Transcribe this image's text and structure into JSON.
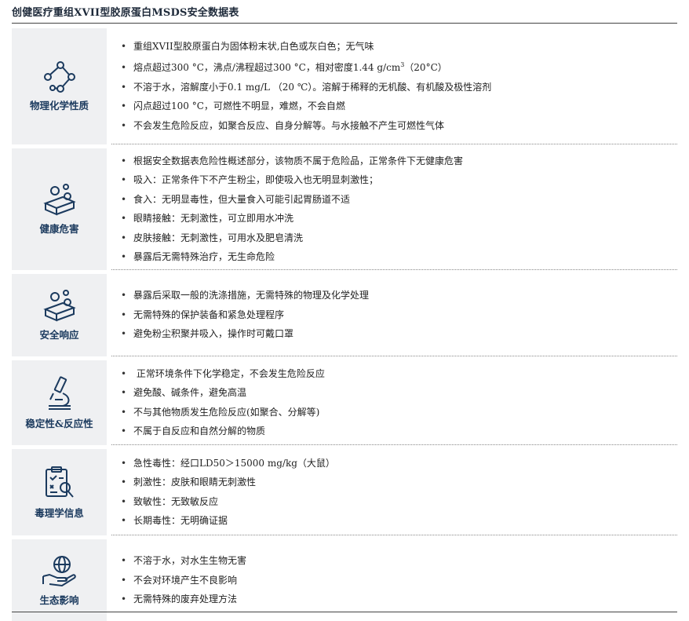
{
  "title": "创健医疗重组XVII型胶原蛋白MSDS安全数据表",
  "colors": {
    "label_bg": "#eff0f2",
    "label_text": "#1b3a5e",
    "icon_stroke": "#1b3a5e"
  },
  "sections": [
    {
      "label": "物理化学性质",
      "icon": "molecule-icon",
      "bullets": [
        "重组XVII型胶原蛋白为固体粉末状,白色或灰白色；无气味",
        "熔点超过300 °C，沸点/沸程超过300 °C，相对密度1.44 g/cm",
        "不溶于水，溶解度小于0.1 mg/L （20 ℃）。溶解于稀释的无机酸、有机酸及极性溶剂",
        "闪点超过100 °C，可燃性不明显，难燃，不会自燃",
        "不会发生危险反应，如聚合反应、自身分解等。与水接触不产生可燃性气体"
      ],
      "bullet2_sup": "3",
      "bullet2_tail": "（20°C）"
    },
    {
      "label": "健康危害",
      "icon": "soap-bubbles-icon",
      "bullets": [
        "根据安全数据表危险性概述部分，该物质不属于危险品，正常条件下无健康危害",
        "吸入：正常条件下不产生粉尘，即使吸入也无明显刺激性；",
        "食入：无明显毒性，但大量食入可能引起胃肠道不适",
        "眼睛接触：无刺激性，可立即用水冲洗",
        "皮肤接触：无刺激性，可用水及肥皂清洗",
        "暴露后无需特殊治疗，无生命危险"
      ]
    },
    {
      "label": "安全响应",
      "icon": "soap-bubbles-icon",
      "bullets": [
        "暴露后采取一般的洗涤措施，无需特殊的物理及化学处理",
        "无需特殊的保护装备和紧急处理程序",
        "避免粉尘积聚并吸入，操作时可戴口罩"
      ]
    },
    {
      "label": "稳定性&反应性",
      "icon": "microscope-icon",
      "bullets": [
        " 正常环境条件下化学稳定，不会发生危险反应",
        "避免酸、碱条件，避免高温",
        "不与其他物质发生危险反应(如聚合、分解等)",
        "不属于自反应和自然分解的物质"
      ]
    },
    {
      "label": "毒理学信息",
      "icon": "clipboard-search-icon",
      "bullets": [
        "急性毒性：经口LD50＞15000 mg/kg（大鼠）",
        "刺激性：皮肤和眼睛无刺激性",
        "致敏性：无致敏反应",
        "长期毒性：无明确证据"
      ]
    },
    {
      "label": "生态影响",
      "icon": "hand-globe-icon",
      "bullets": [
        "不溶于水，对水生生物无害",
        "不会对环境产生不良影响",
        "无需特殊的废弃处理方法"
      ]
    }
  ]
}
